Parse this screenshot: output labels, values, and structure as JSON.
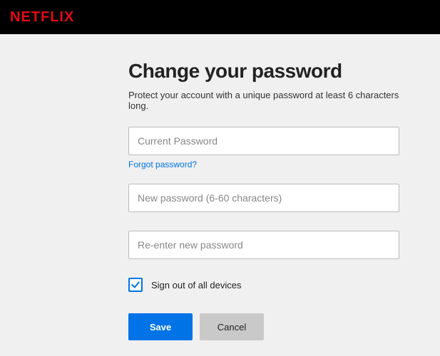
{
  "header": {
    "brand": "NETFLIX"
  },
  "page": {
    "title": "Change your password",
    "subtitle": "Protect your account with a unique password at least 6 characters long."
  },
  "fields": {
    "current_password": {
      "placeholder": "Current Password",
      "value": ""
    },
    "new_password": {
      "placeholder": "New password (6-60 characters)",
      "value": ""
    },
    "confirm_password": {
      "placeholder": "Re-enter new password",
      "value": ""
    },
    "forgot_link": "Forgot password?"
  },
  "checkbox": {
    "label": "Sign out of all devices",
    "checked": true
  },
  "buttons": {
    "save": "Save",
    "cancel": "Cancel"
  }
}
